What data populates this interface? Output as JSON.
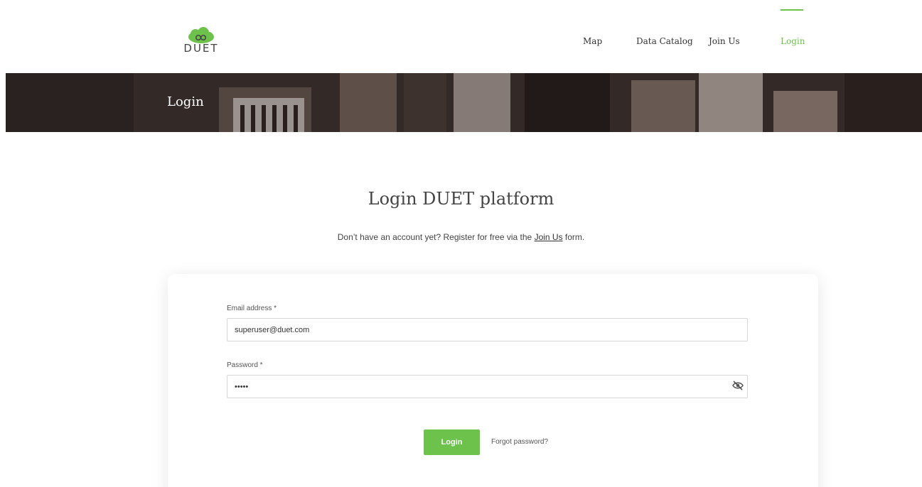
{
  "brand": {
    "logo_text": "DUET",
    "accent": "#6cc24a"
  },
  "nav": {
    "items": [
      {
        "label": "Map",
        "active": false
      },
      {
        "label": "Data Catalog",
        "active": false
      },
      {
        "label": "Join Us",
        "active": false
      },
      {
        "label": "Login",
        "active": true
      }
    ]
  },
  "hero": {
    "title": "Login"
  },
  "main": {
    "title": "Login DUET platform",
    "subtitle_before": "Don’t have an account yet? Register for free via the ",
    "subtitle_link": "Join Us",
    "subtitle_after": " form."
  },
  "form": {
    "email_label": "Email address *",
    "email_value": "superuser@duet.com",
    "password_label": "Password *",
    "password_value": "•••••",
    "password_toggle_icon": "eye-slash-icon",
    "login_label": "Login",
    "forgot_label": "Forgot password?"
  }
}
